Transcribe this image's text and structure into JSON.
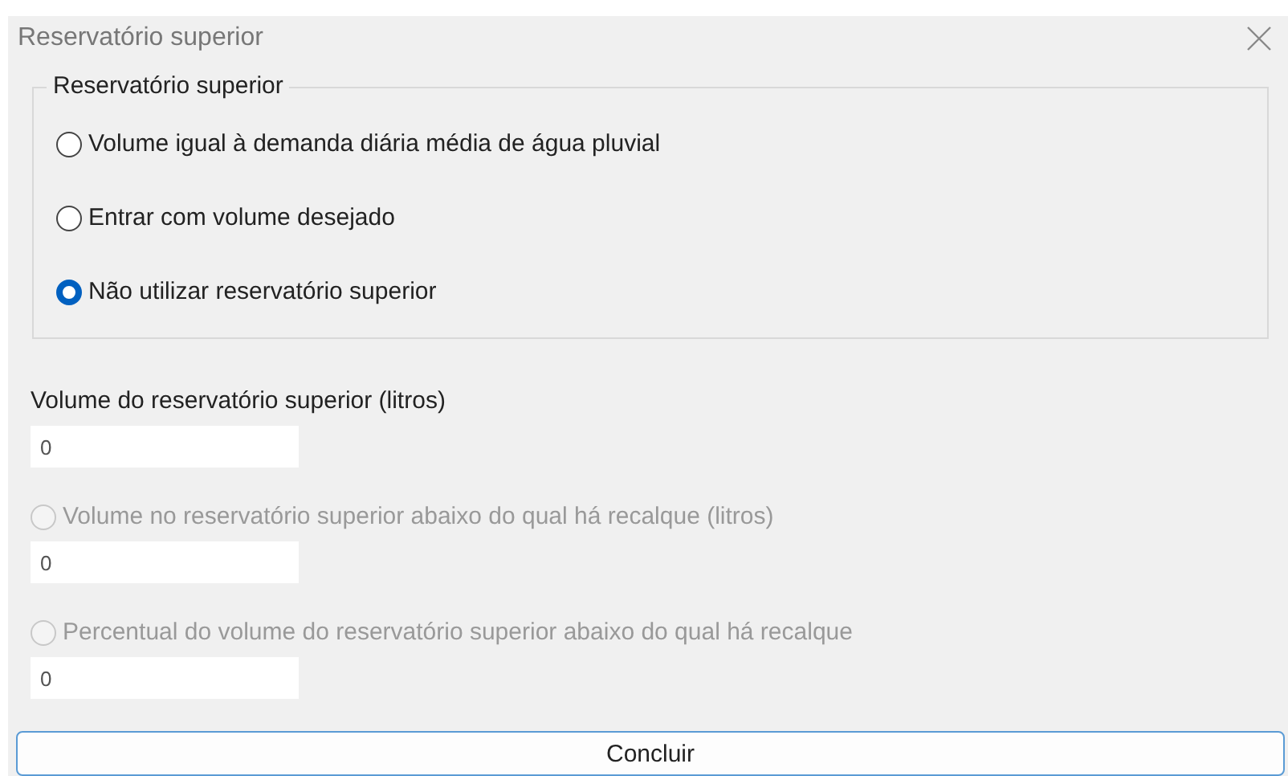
{
  "window": {
    "title": "Reservatório superior"
  },
  "group": {
    "title": "Reservatório superior",
    "options": [
      {
        "label": "Volume igual à demanda diária média de água pluvial",
        "selected": false
      },
      {
        "label": "Entrar com volume desejado",
        "selected": false
      },
      {
        "label": "Não utilizar reservatório superior",
        "selected": true
      }
    ]
  },
  "volume": {
    "label": "Volume do reservatório superior (litros)",
    "value": "0"
  },
  "options": [
    {
      "label": "Volume no reservatório superior abaixo do qual há recalque (litros)",
      "selected": false,
      "disabled": true,
      "value": "0"
    },
    {
      "label": "Percentual do volume do reservatório superior abaixo do qual há recalque",
      "selected": false,
      "disabled": true,
      "value": "0"
    }
  ],
  "buttons": [
    "Concluir"
  ]
}
